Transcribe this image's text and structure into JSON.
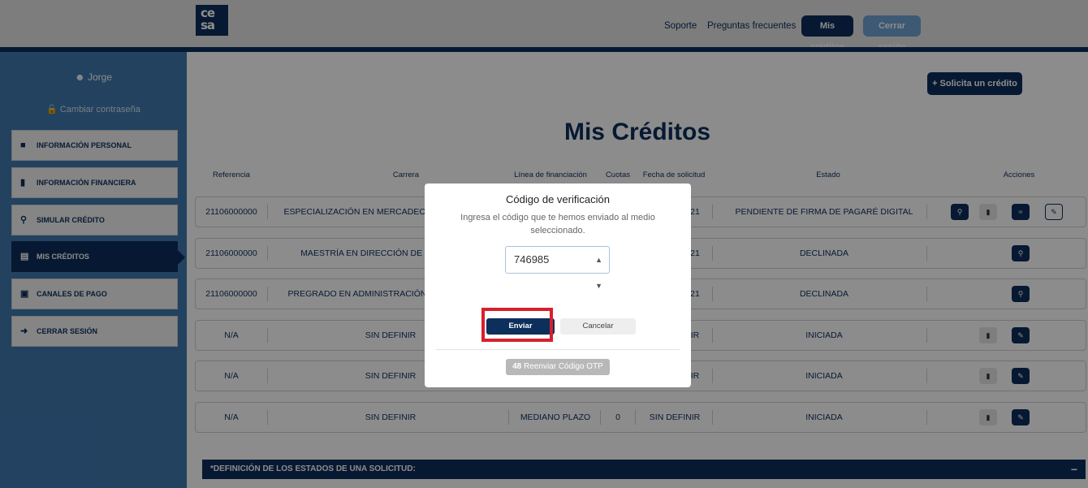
{
  "header": {
    "logo_text": "ce\nsa",
    "nav": {
      "soporte": "Soporte",
      "faq": "Preguntas frecuentes",
      "mis_creditos": "Mis créditos",
      "cerrar_sesion": "Cerrar sesión"
    }
  },
  "sidebar": {
    "user_name": "Jorge",
    "change_password": "Cambiar contraseña",
    "items": [
      {
        "label": "INFORMACIÓN PERSONAL",
        "icon": "user-icon"
      },
      {
        "label": "INFORMACIÓN FINANCIERA",
        "icon": "document-icon"
      },
      {
        "label": "SIMULAR CRÉDITO",
        "icon": "search-icon"
      },
      {
        "label": "MIS CRÉDITOS",
        "icon": "card-icon",
        "active": true
      },
      {
        "label": "CANALES DE PAGO",
        "icon": "cart-icon"
      },
      {
        "label": "CERRAR SESIÓN",
        "icon": "logout-icon"
      }
    ]
  },
  "main": {
    "solicita_button": "+ Solicita un crédito",
    "title": "Mis Créditos",
    "columns": [
      "Referencia",
      "Carrera",
      "Línea de financiación",
      "Cuotas",
      "Fecha de solicitud",
      "Estado",
      "Acciones"
    ],
    "rows": [
      {
        "ref": "21106000000",
        "carrera": "ESPECIALIZACIÓN EN MERCADEO",
        "fecha": "21",
        "estado": "PENDIENTE DE FIRMA DE PAGARÉ DIGITAL"
      },
      {
        "ref": "21106000000",
        "carrera": "MAESTRÍA EN DIRECCIÓN DE M",
        "fecha": "21",
        "estado": "DECLINADA"
      },
      {
        "ref": "21106000000",
        "carrera": "PREGRADO EN ADMINISTRACIÓN",
        "fecha": "21",
        "estado": "DECLINADA"
      },
      {
        "ref": "N/A",
        "carrera": "SIN DEFINIR",
        "fecha": "IR",
        "estado": "INICIADA"
      },
      {
        "ref": "N/A",
        "carrera": "SIN DEFINIR",
        "fecha": "IR",
        "estado": "INICIADA"
      },
      {
        "ref": "N/A",
        "carrera": "SIN DEFINIR",
        "linea": "MEDIANO PLAZO",
        "cuotas": "0",
        "fecha": "SIN DEFINIR",
        "estado": "INICIADA"
      }
    ],
    "definitions_bar": "*DEFINICIÓN DE LOS ESTADOS DE UNA SOLICITUD:",
    "definitions_toggle": "−"
  },
  "modal": {
    "title": "Código de verificación",
    "subtitle": "Ingresa el código que te hemos enviado al medio seleccionado.",
    "code_value": "746985",
    "send_button": "Enviar",
    "cancel_button": "Cancelar",
    "resend_countdown": "48",
    "resend_label": "Reenviar Código OTP"
  },
  "colors": {
    "brand_navy": "#0d2f5c",
    "sidebar_blue": "#3f79b0",
    "highlight_red": "#d6202b"
  }
}
